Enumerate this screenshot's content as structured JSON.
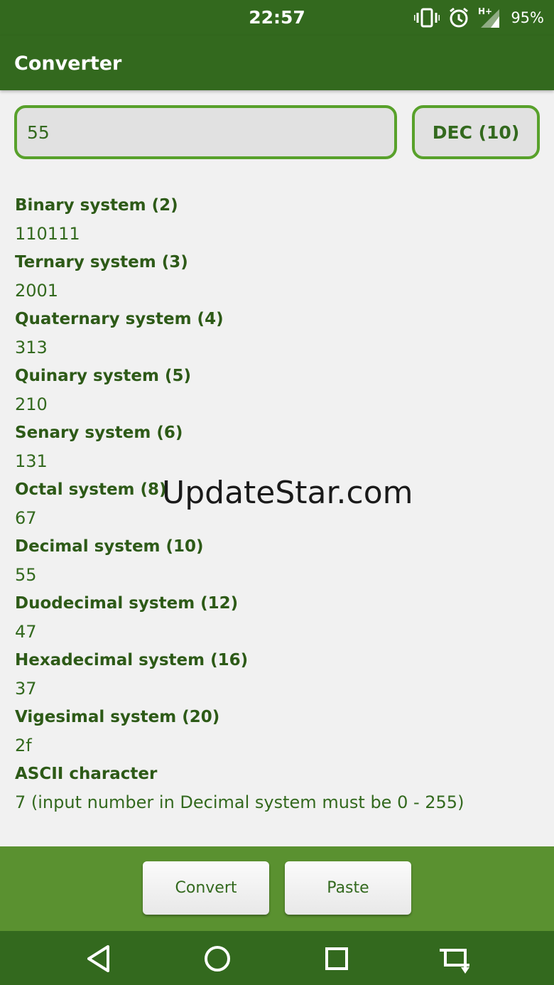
{
  "status_bar": {
    "time": "22:57",
    "network": "H+",
    "battery": "95%",
    "icons": [
      "vibrate-icon",
      "alarm-icon",
      "signal-icon"
    ]
  },
  "app_bar": {
    "title": "Converter"
  },
  "input": {
    "value": "55",
    "base_button": "DEC (10)"
  },
  "results": [
    {
      "label": "Binary system (2)",
      "value": "110111"
    },
    {
      "label": "Ternary system (3)",
      "value": "2001"
    },
    {
      "label": "Quaternary system (4)",
      "value": "313"
    },
    {
      "label": "Quinary system (5)",
      "value": "210"
    },
    {
      "label": "Senary system (6)",
      "value": "131"
    },
    {
      "label": "Octal system (8)",
      "value": "67"
    },
    {
      "label": "Decimal system (10)",
      "value": "55"
    },
    {
      "label": "Duodecimal system (12)",
      "value": "47"
    },
    {
      "label": "Hexadecimal system (16)",
      "value": "37"
    },
    {
      "label": "Vigesimal system (20)",
      "value": "2f"
    },
    {
      "label": "ASCII character",
      "value": "7 (input number in Decimal system must be 0 - 255)"
    }
  ],
  "watermark": "UpdateStar.com",
  "actions": {
    "convert": "Convert",
    "paste": "Paste"
  },
  "nav_bar": {
    "icons": [
      "back-icon",
      "home-icon",
      "recents-icon",
      "rotate-icon"
    ]
  },
  "colors": {
    "primary_dark": "#33691e",
    "accent": "#58a12b",
    "panel": "#5a9130",
    "background": "#f1f1f1"
  }
}
